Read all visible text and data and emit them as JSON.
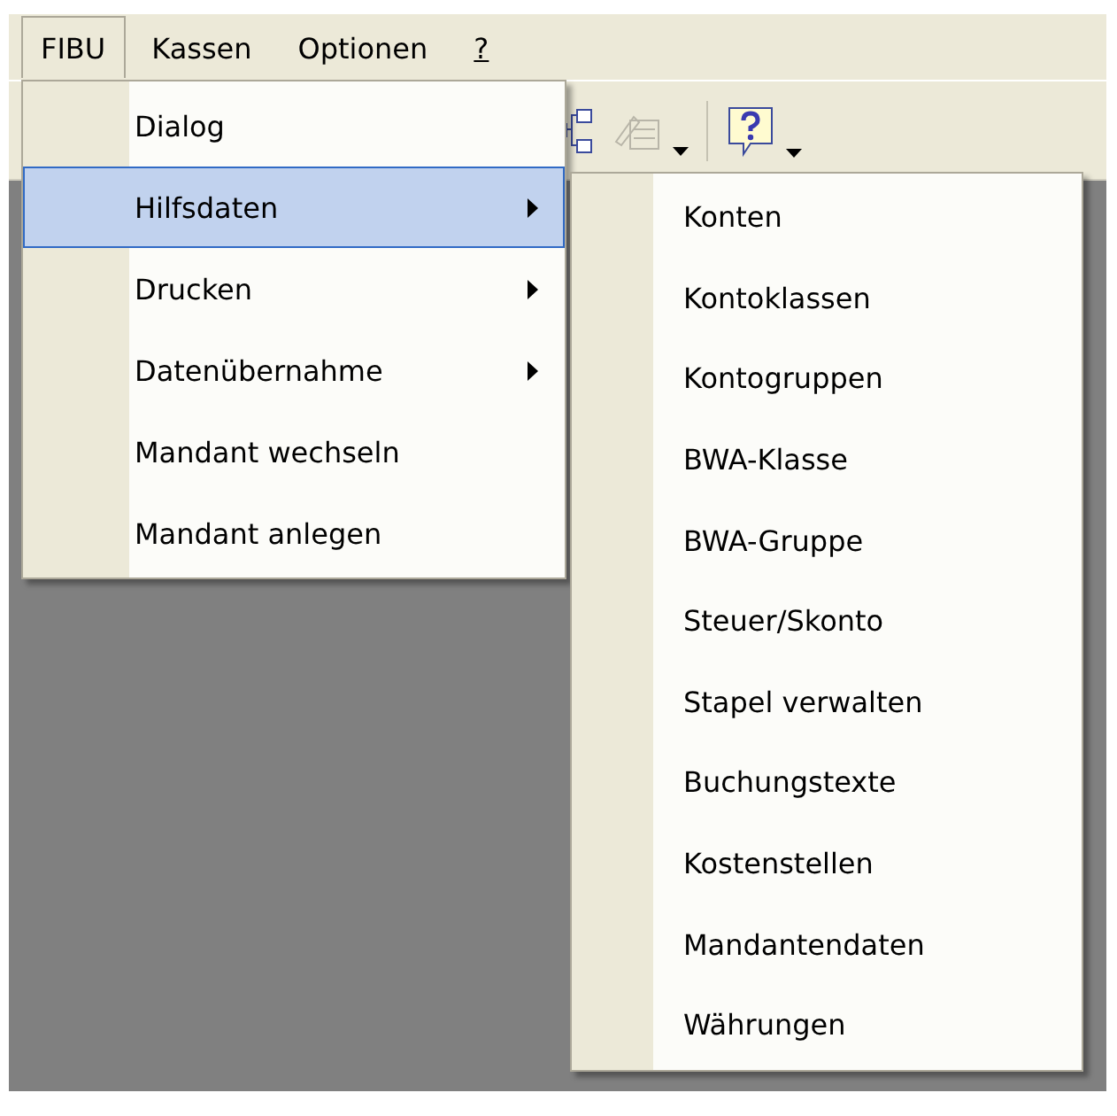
{
  "menu_bar": [
    {
      "label": "FIBU",
      "open": true,
      "underlined": false
    },
    {
      "label": "Kassen",
      "open": false,
      "underlined": false
    },
    {
      "label": "Optionen",
      "open": false,
      "underlined": false
    },
    {
      "label": "?",
      "open": false,
      "underlined": true
    }
  ],
  "toolbar": [
    {
      "kind": "tree",
      "disabled": false,
      "dropdown": false
    },
    {
      "kind": "form",
      "disabled": true,
      "dropdown": true
    },
    {
      "kind": "help",
      "disabled": false,
      "dropdown": true
    }
  ],
  "menu": [
    {
      "label": "Dialog",
      "submenu": false,
      "selected": false
    },
    {
      "label": "Hilfsdaten",
      "submenu": true,
      "selected": true
    },
    {
      "label": "Drucken",
      "submenu": true,
      "selected": false
    },
    {
      "label": "Datenübernahme",
      "submenu": true,
      "selected": false
    },
    {
      "label": "Mandant wechseln",
      "submenu": false,
      "selected": false
    },
    {
      "label": "Mandant anlegen",
      "submenu": false,
      "selected": false
    }
  ],
  "submenu": [
    {
      "label": "Konten"
    },
    {
      "label": "Kontoklassen"
    },
    {
      "label": "Kontogruppen"
    },
    {
      "label": "BWA-Klasse"
    },
    {
      "label": "BWA-Gruppe"
    },
    {
      "label": "Steuer/Skonto"
    },
    {
      "label": "Stapel verwalten"
    },
    {
      "label": "Buchungstexte"
    },
    {
      "label": "Kostenstellen"
    },
    {
      "label": "Mandantendaten"
    },
    {
      "label": "Währungen"
    }
  ]
}
